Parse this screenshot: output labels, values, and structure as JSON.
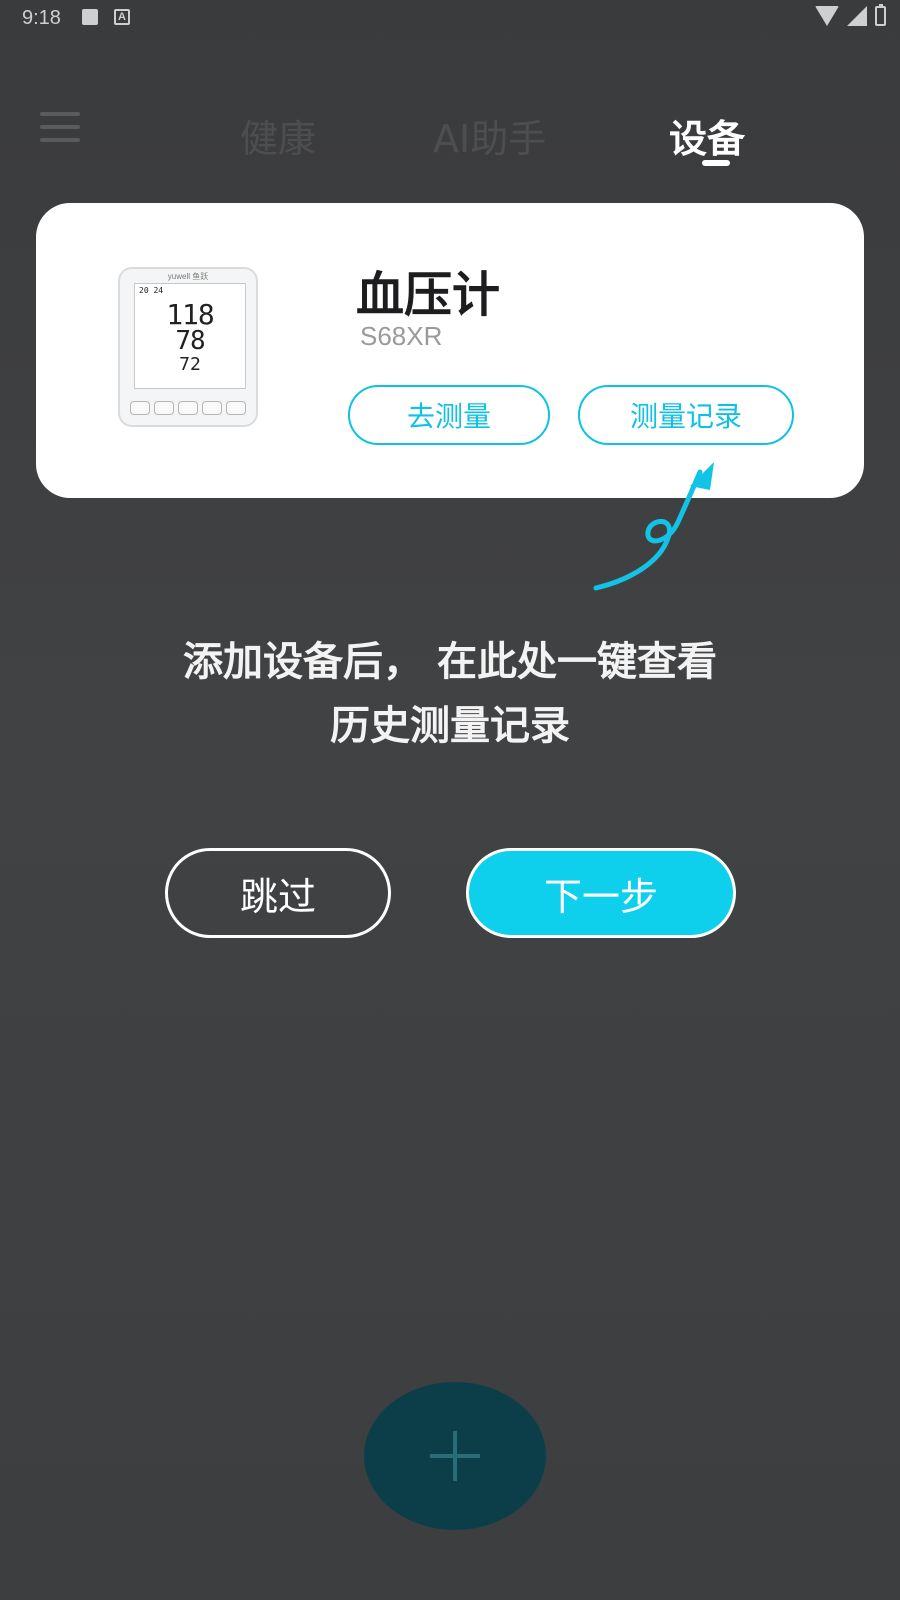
{
  "status_bar": {
    "time": "9:18",
    "icons": [
      "image-icon",
      "a-notification-icon",
      "wifi-icon",
      "signal-icon",
      "battery-icon"
    ]
  },
  "top_nav": {
    "menu_icon": "hamburger-menu-icon",
    "tabs": [
      {
        "label": "健康",
        "active": false
      },
      {
        "label": "AI助手",
        "active": false
      },
      {
        "label": "设备",
        "active": true
      }
    ]
  },
  "device_card": {
    "name": "血压计",
    "model": "S68XR",
    "image": {
      "brand": "yuwell 鱼跃",
      "datetime": "20 24",
      "systolic": "118",
      "diastolic": "78",
      "pulse": "72"
    },
    "buttons": {
      "measure": "去测量",
      "records": "测量记录"
    }
  },
  "guide": {
    "hint_line1": "添加设备后， 在此处一键查看",
    "hint_line2": "历史测量记录"
  },
  "actions": {
    "skip": "跳过",
    "next": "下一步"
  },
  "fab": {
    "icon": "plus-icon"
  },
  "colors": {
    "accent": "#0fc2e3",
    "next_button": "#0fd0ec",
    "overlay_bg": "#3f4042",
    "fab": "#0c3e4a"
  }
}
